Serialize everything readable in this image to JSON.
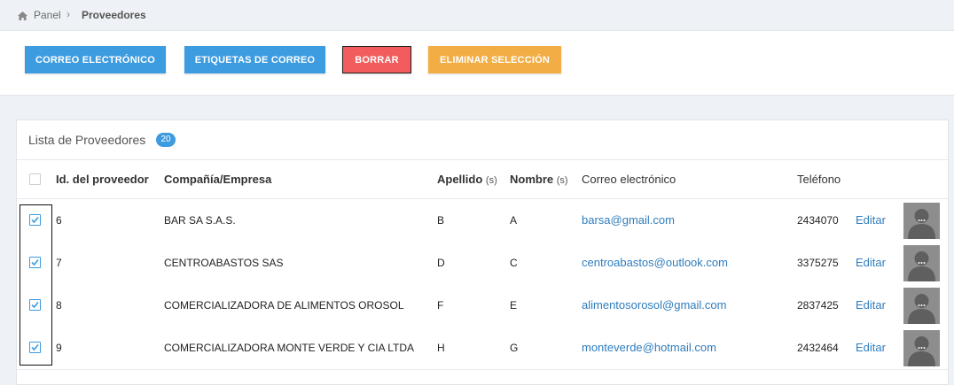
{
  "breadcrumb": {
    "home": "Panel",
    "separator": "›",
    "current": "Proveedores"
  },
  "toolbar": {
    "email_button": "CORREO ELECTRÓNICO",
    "labels_button": "ETIQUETAS DE CORREO",
    "delete_button": "BORRAR",
    "remove_selection_button": "ELIMINAR SELECCIÓN"
  },
  "panel": {
    "title": "Lista de Proveedores",
    "count": "20"
  },
  "table": {
    "headers": {
      "id": "Id. del proveedor",
      "company": "Compañía/Empresa",
      "last_name": "Apellido",
      "last_name_suffix": "(s)",
      "first_name": "Nombre",
      "first_name_suffix": "(s)",
      "email": "Correo electrónico",
      "phone": "Teléfono"
    },
    "rows": [
      {
        "checked": true,
        "id": "6",
        "company": "BAR SA S.A.S.",
        "last_name": "B",
        "first_name": "A",
        "email": "barsa@gmail.com",
        "phone": "2434070",
        "edit": "Editar"
      },
      {
        "checked": true,
        "id": "7",
        "company": "CENTROABASTOS SAS",
        "last_name": "D",
        "first_name": "C",
        "email": "centroabastos@outlook.com",
        "phone": "3375275",
        "edit": "Editar"
      },
      {
        "checked": true,
        "id": "8",
        "company": "COMERCIALIZADORA DE ALIMENTOS OROSOL",
        "last_name": "F",
        "first_name": "E",
        "email": "alimentosorosol@gmail.com",
        "phone": "2837425",
        "edit": "Editar"
      },
      {
        "checked": true,
        "id": "9",
        "company": "COMERCIALIZADORA MONTE VERDE Y CIA LTDA",
        "last_name": "H",
        "first_name": "G",
        "email": "monteverde@hotmail.com",
        "phone": "2432464",
        "edit": "Editar"
      }
    ]
  },
  "icons": {
    "home": "home-icon",
    "check": "checkmark-icon",
    "avatar": "user-silhouette-icon"
  },
  "colors": {
    "primary": "#3d9be0",
    "danger": "#f25c5c",
    "warning": "#f2ad45",
    "link": "#2f7dbd",
    "background": "#eef1f5"
  }
}
